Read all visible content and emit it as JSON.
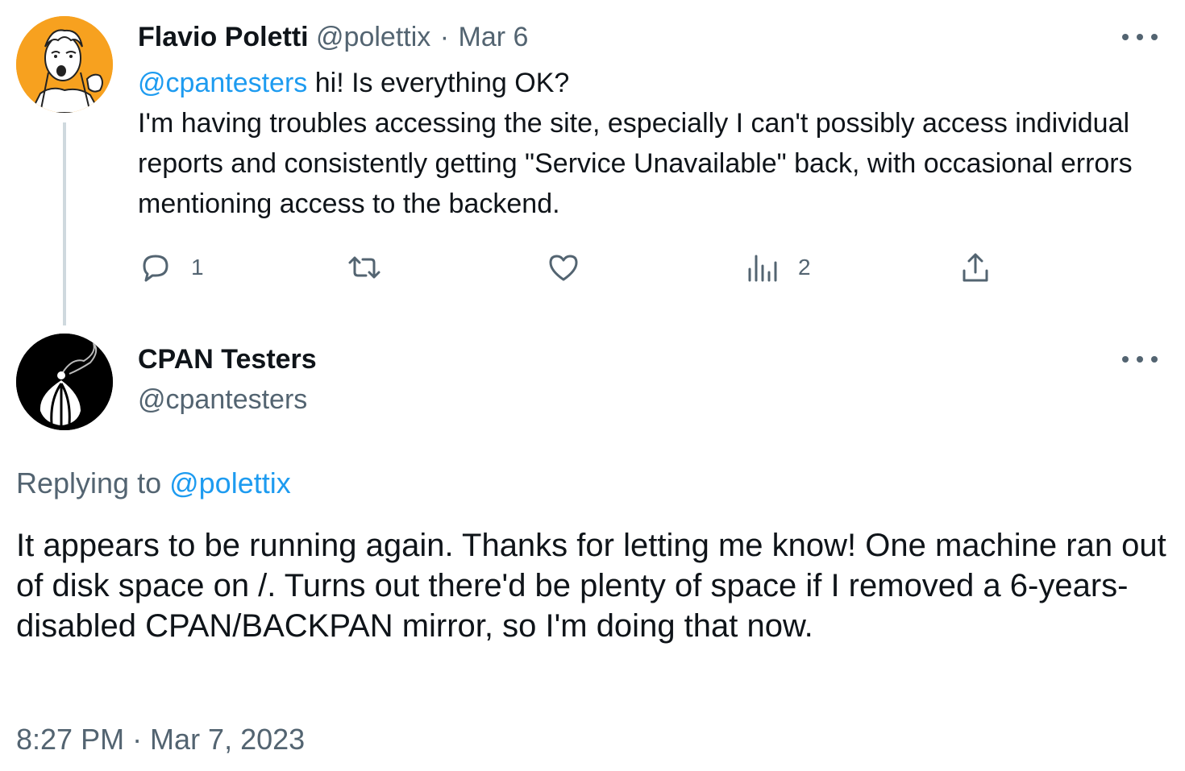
{
  "reply_tweet": {
    "author_name": "Flavio Poletti",
    "handle": "@polettix",
    "separator": "·",
    "date": "Mar 6",
    "mention": "@cpantesters",
    "line1_rest": " hi! Is everything OK?",
    "body": "I'm having troubles accessing the site, especially I can't possibly access individual reports and consistently getting \"Service Unavailable\" back, with occasional errors mentioning access to the backend.",
    "actions": {
      "reply_count": "1",
      "views_count": "2"
    },
    "avatar_icon": "cartoon-portrait-avatar",
    "avatar_bg": "#f7a11f"
  },
  "main_tweet": {
    "author_name": "CPAN Testers",
    "handle": "@cpantesters",
    "replying_prefix": "Replying to ",
    "replying_handle": "@polettix",
    "text": "It appears to be running again. Thanks for letting me know! One machine ran out of disk space on /. Turns out there'd be plenty of space if I removed a 6-years-disabled CPAN/BACKPAN mirror, so I'm doing that now.",
    "timestamp": "8:27 PM · Mar 7, 2023",
    "avatar_icon": "onion-avatar",
    "avatar_bg": "#000000"
  },
  "colors": {
    "text": "#0f1419",
    "muted": "#536471",
    "link": "#1d9bf0",
    "thread_line": "#cfd9de"
  }
}
